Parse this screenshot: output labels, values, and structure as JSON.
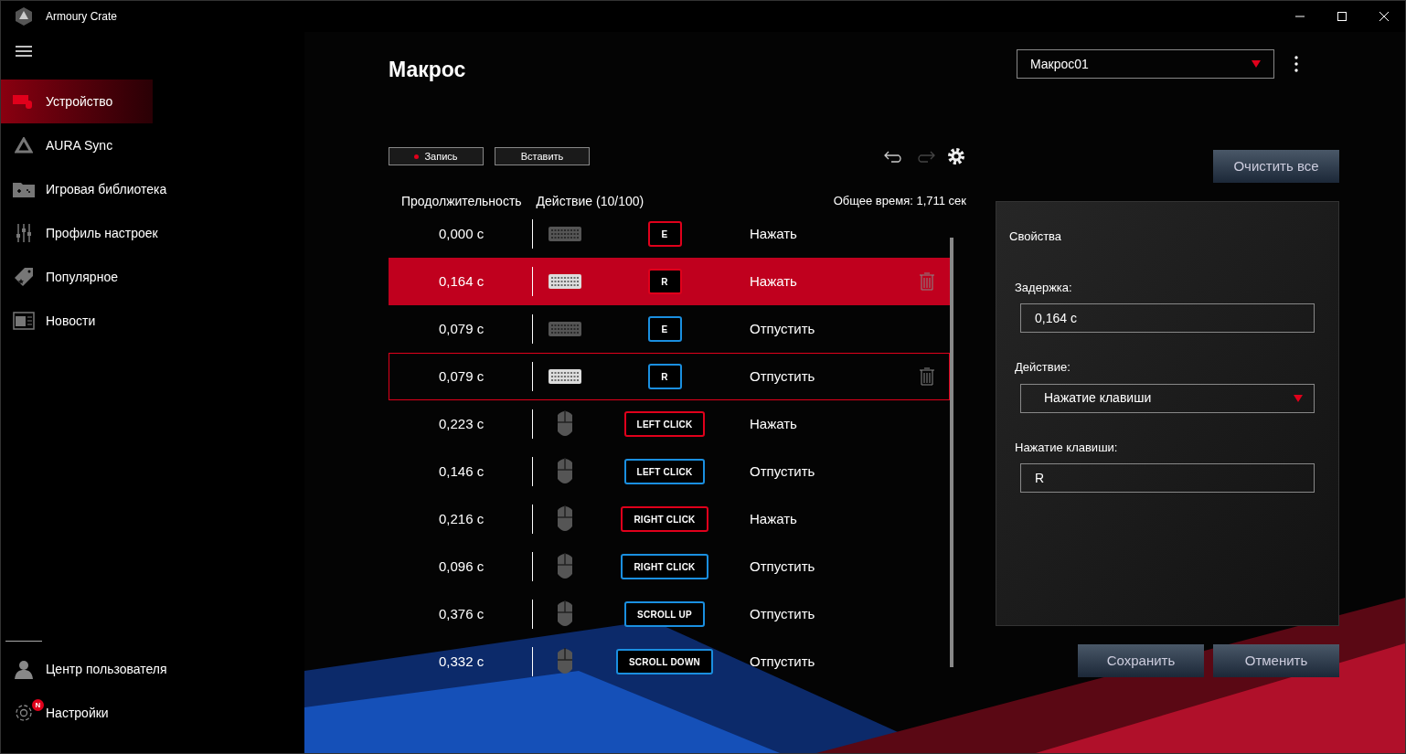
{
  "window": {
    "title": "Armoury Crate"
  },
  "sidebar": {
    "items": [
      {
        "label": "Устройство",
        "selected": true
      },
      {
        "label": "AURA Sync",
        "selected": false
      },
      {
        "label": "Игровая библиотека",
        "selected": false
      },
      {
        "label": "Профиль настроек",
        "selected": false
      },
      {
        "label": "Популярное",
        "selected": false
      },
      {
        "label": "Новости",
        "selected": false
      }
    ],
    "bottom_items": [
      {
        "label": "Центр пользователя"
      },
      {
        "label": "Настройки",
        "badge": "N"
      }
    ]
  },
  "page": {
    "title": "Макрос",
    "macro_select": {
      "value": "Макрос01"
    }
  },
  "toolbar": {
    "record": "Запись",
    "insert": "Вставить",
    "clear_all": "Очистить все"
  },
  "table": {
    "columns": [
      "Продолжительность",
      "Действие (10/100)"
    ],
    "total": "Общее время: 1,711 сек",
    "rows": [
      {
        "duration": "0,000 с",
        "kind": "keyboard",
        "key": "E",
        "color": "#e0001b",
        "action": "Нажать",
        "selected": false,
        "outlined": false
      },
      {
        "duration": "0,164 с",
        "kind": "keyboard",
        "key": "R",
        "color": "#e0001b",
        "action": "Нажать",
        "selected": true,
        "outlined": false
      },
      {
        "duration": "0,079 с",
        "kind": "keyboard",
        "key": "E",
        "color": "#1a8fe0",
        "action": "Отпустить",
        "selected": false,
        "outlined": false
      },
      {
        "duration": "0,079 с",
        "kind": "keyboard",
        "key": "R",
        "color": "#1a8fe0",
        "action": "Отпустить",
        "selected": false,
        "outlined": true
      },
      {
        "duration": "0,223 с",
        "kind": "mouse",
        "key": "LEFT CLICK",
        "color": "#e0001b",
        "action": "Нажать",
        "selected": false,
        "outlined": false
      },
      {
        "duration": "0,146 с",
        "kind": "mouse",
        "key": "LEFT CLICK",
        "color": "#1a8fe0",
        "action": "Отпустить",
        "selected": false,
        "outlined": false
      },
      {
        "duration": "0,216 с",
        "kind": "mouse",
        "key": "RIGHT CLICK",
        "color": "#e0001b",
        "action": "Нажать",
        "selected": false,
        "outlined": false
      },
      {
        "duration": "0,096 с",
        "kind": "mouse",
        "key": "RIGHT CLICK",
        "color": "#1a8fe0",
        "action": "Отпустить",
        "selected": false,
        "outlined": false
      },
      {
        "duration": "0,376 с",
        "kind": "mouse",
        "key": "SCROLL UP",
        "color": "#1a8fe0",
        "action": "Отпустить",
        "selected": false,
        "outlined": false
      },
      {
        "duration": "0,332 с",
        "kind": "mouse",
        "key": "SCROLL DOWN",
        "color": "#1a8fe0",
        "action": "Отпустить",
        "selected": false,
        "outlined": false
      }
    ]
  },
  "properties": {
    "title": "Свойства",
    "delay": {
      "label": "Задержка:",
      "value": "0,164 с"
    },
    "action": {
      "label": "Действие:",
      "value": "Нажатие клавиши"
    },
    "key": {
      "label": "Нажатие клавиши:",
      "value": "R"
    }
  },
  "buttons": {
    "save": "Сохранить",
    "cancel": "Отменить"
  }
}
